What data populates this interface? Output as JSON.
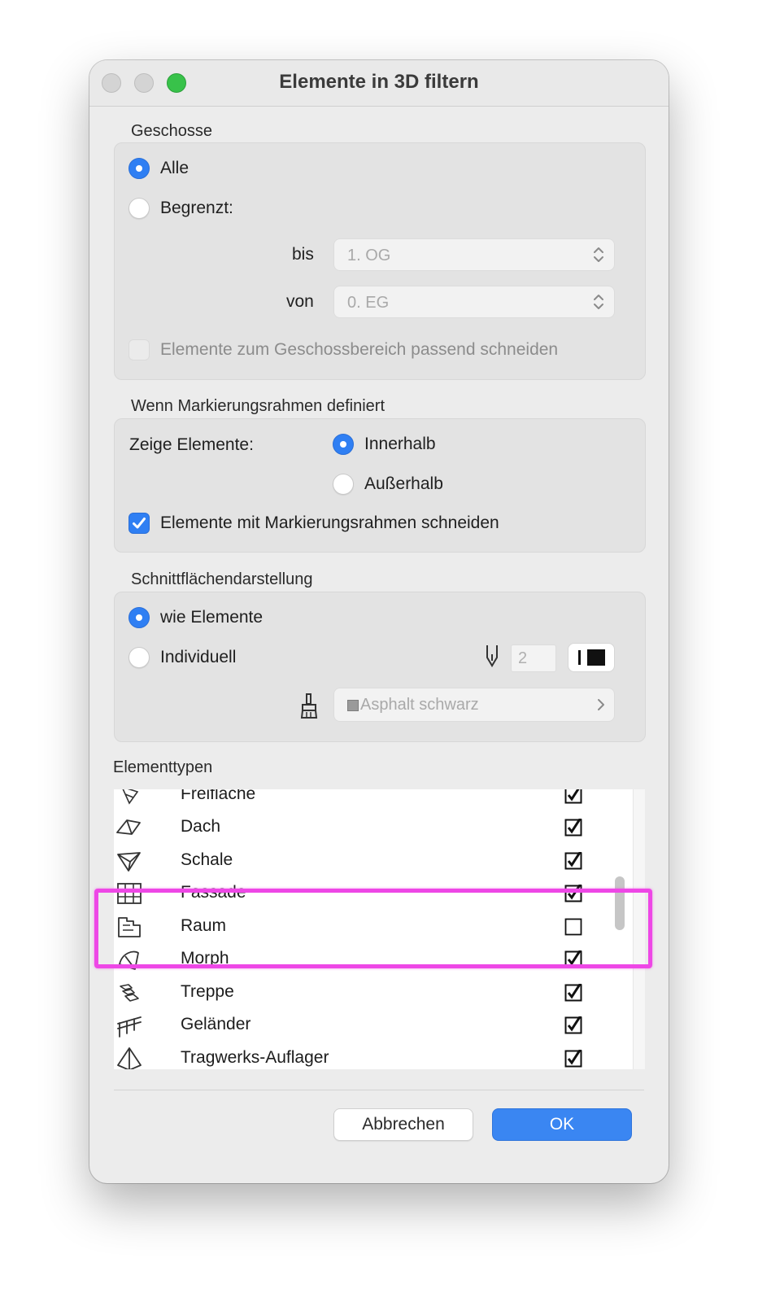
{
  "window": {
    "title": "Elemente in 3D filtern"
  },
  "geschosse": {
    "label": "Geschosse",
    "alle_label": "Alle",
    "begrenzt_label": "Begrenzt:",
    "bis_label": "bis",
    "bis_value": "1. OG",
    "von_label": "von",
    "von_value": "0. EG",
    "cut_label": "Elemente zum Geschossbereich passend schneiden"
  },
  "markierung": {
    "label": "Wenn Markierungsrahmen definiert",
    "zeige_label": "Zeige Elemente:",
    "innerhalb_label": "Innerhalb",
    "ausserhalb_label": "Außerhalb",
    "cut_label": "Elemente mit  Markierungsrahmen schneiden"
  },
  "schnitt": {
    "label": "Schnittflächendarstellung",
    "wie_label": "wie Elemente",
    "individuell_label": "Individuell",
    "pen_value": "2",
    "fill_value": "Asphalt schwarz"
  },
  "elementtypen": {
    "label": "Elementtypen",
    "items": [
      {
        "name": "Freifläche",
        "icon": "mesh-icon",
        "checked": true
      },
      {
        "name": "Dach",
        "icon": "roof-icon",
        "checked": true
      },
      {
        "name": "Schale",
        "icon": "shell-icon",
        "checked": true
      },
      {
        "name": "Fassade",
        "icon": "curtain-wall-icon",
        "checked": true
      },
      {
        "name": "Raum",
        "icon": "zone-icon",
        "checked": false
      },
      {
        "name": "Morph",
        "icon": "morph-icon",
        "checked": true
      },
      {
        "name": "Treppe",
        "icon": "stair-icon",
        "checked": true
      },
      {
        "name": "Geländer",
        "icon": "railing-icon",
        "checked": true
      },
      {
        "name": "Tragwerks-Auflager",
        "icon": "structural-support-icon",
        "checked": true
      }
    ]
  },
  "buttons": {
    "cancel_label": "Abbrechen",
    "ok_label": "OK"
  },
  "colors": {
    "accent": "#2f7ff3",
    "highlight": "#ee47e6",
    "window_bg": "#ececec"
  }
}
